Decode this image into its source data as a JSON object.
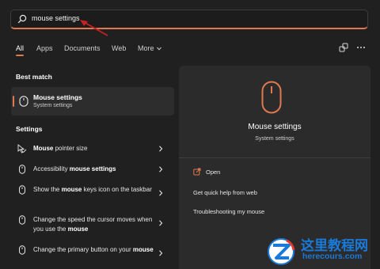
{
  "search": {
    "value": "mouse settings"
  },
  "tabs": [
    "All",
    "Apps",
    "Documents",
    "Web",
    "More"
  ],
  "top_icons": [
    "share-icon",
    "more-options-icon"
  ],
  "best_match": {
    "label": "Best match",
    "title": "Mouse settings",
    "subtitle": "System settings"
  },
  "settings_section": {
    "label": "Settings",
    "items": [
      {
        "pre": "",
        "bold": "Mouse",
        "post": " pointer size",
        "icon": "mouse-pointer-icon"
      },
      {
        "pre": "Accessibility ",
        "bold": "mouse settings",
        "post": "",
        "icon": "mouse-icon"
      },
      {
        "pre": "Show the ",
        "bold": "mouse",
        "post": " keys icon on the taskbar",
        "icon": "mouse-icon"
      },
      {
        "pre": "Change the speed the cursor moves when you use the ",
        "bold": "mouse",
        "post": "",
        "icon": "mouse-icon"
      },
      {
        "pre": "Change the primary button on your ",
        "bold": "mouse",
        "post": "",
        "icon": "mouse-icon"
      }
    ]
  },
  "detail": {
    "title": "Mouse settings",
    "subtitle": "System settings",
    "actions": {
      "open": "Open",
      "quick_help": "Get quick help from web",
      "troubleshoot": "Troubleshooting my mouse"
    }
  },
  "watermark": {
    "cn": "这里教程网",
    "en": "herecours.com"
  },
  "colors": {
    "accent": "#e0794f",
    "background": "#202020",
    "panel": "#2b2b2b",
    "watermark": "#1a7ad9"
  }
}
